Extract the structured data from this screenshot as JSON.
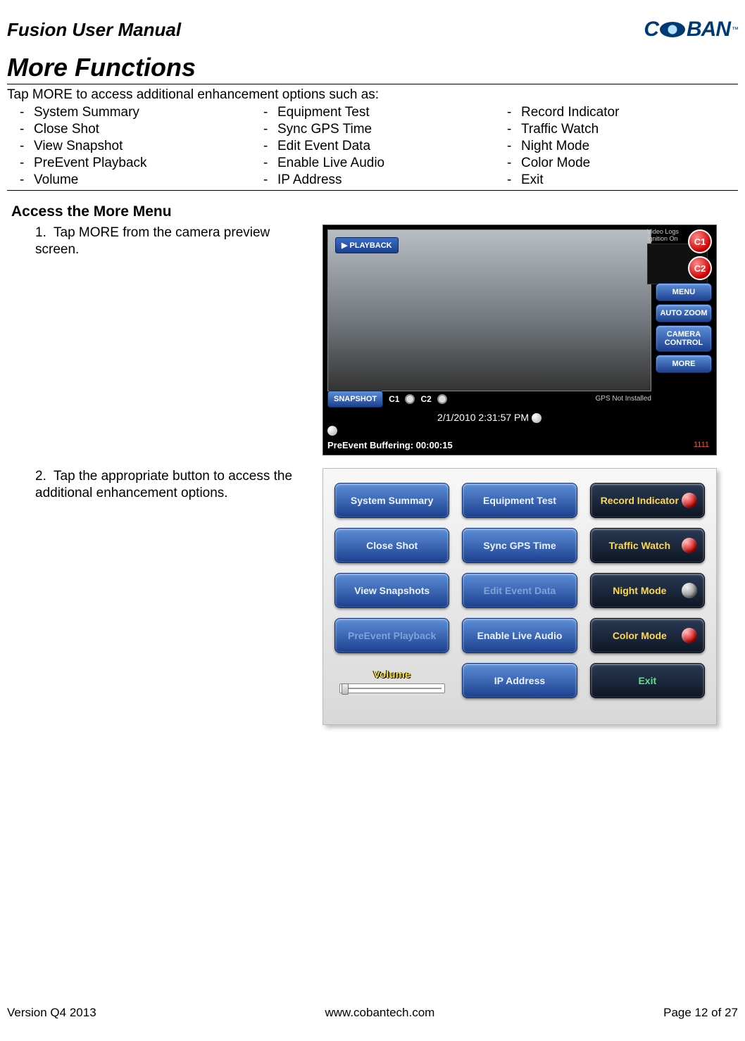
{
  "header": {
    "title": "Fusion User Manual",
    "brand": "COBAN",
    "tm": "™"
  },
  "section": {
    "title": "More Functions",
    "intro": "Tap MORE to access additional enhancement options such as:",
    "columns": [
      [
        "System Summary",
        "Close Shot",
        "View Snapshot",
        "PreEvent Playback",
        "Volume"
      ],
      [
        "Equipment Test",
        "Sync GPS Time",
        "Edit Event Data",
        "Enable Live Audio",
        "IP Address"
      ],
      [
        "Record Indicator",
        "Traffic Watch",
        "Night Mode",
        "Color Mode",
        "Exit"
      ]
    ]
  },
  "access": {
    "heading": "Access the More Menu",
    "steps": [
      {
        "num": "1.",
        "text": "Tap MORE from the camera preview screen."
      },
      {
        "num": "2.",
        "text": "Tap the appropriate button to access the additional enhancement options."
      }
    ]
  },
  "shot1": {
    "playback": "PLAYBACK",
    "videoLogs": "Video Logs",
    "ignition": "Ignition On",
    "right": [
      "C1",
      "C2",
      "MENU",
      "AUTO ZOOM",
      "CAMERA CONTROL",
      "MORE"
    ],
    "snapshot": "SNAPSHOT",
    "c1": "C1",
    "c2": "C2",
    "gps": "GPS Not Installed",
    "time": "2/1/2010 2:31:57 PM",
    "buffer": "PreEvent Buffering: 00:00:15",
    "idx": "1111"
  },
  "shot2": {
    "volume": "Volume",
    "buttons": {
      "systemSummary": "System Summary",
      "equipmentTest": "Equipment Test",
      "recordIndicator": "Record Indicator",
      "closeShot": "Close Shot",
      "syncGps": "Sync GPS Time",
      "trafficWatch": "Traffic Watch",
      "viewSnapshots": "View Snapshots",
      "editEvent": "Edit Event Data",
      "nightMode": "Night Mode",
      "preEvent": "PreEvent Playback",
      "enableLive": "Enable Live Audio",
      "colorMode": "Color Mode",
      "ipAddress": "IP Address",
      "exit": "Exit"
    }
  },
  "footer": {
    "version": "Version Q4 2013",
    "url": "www.cobantech.com",
    "page": "Page 12 of 27"
  }
}
